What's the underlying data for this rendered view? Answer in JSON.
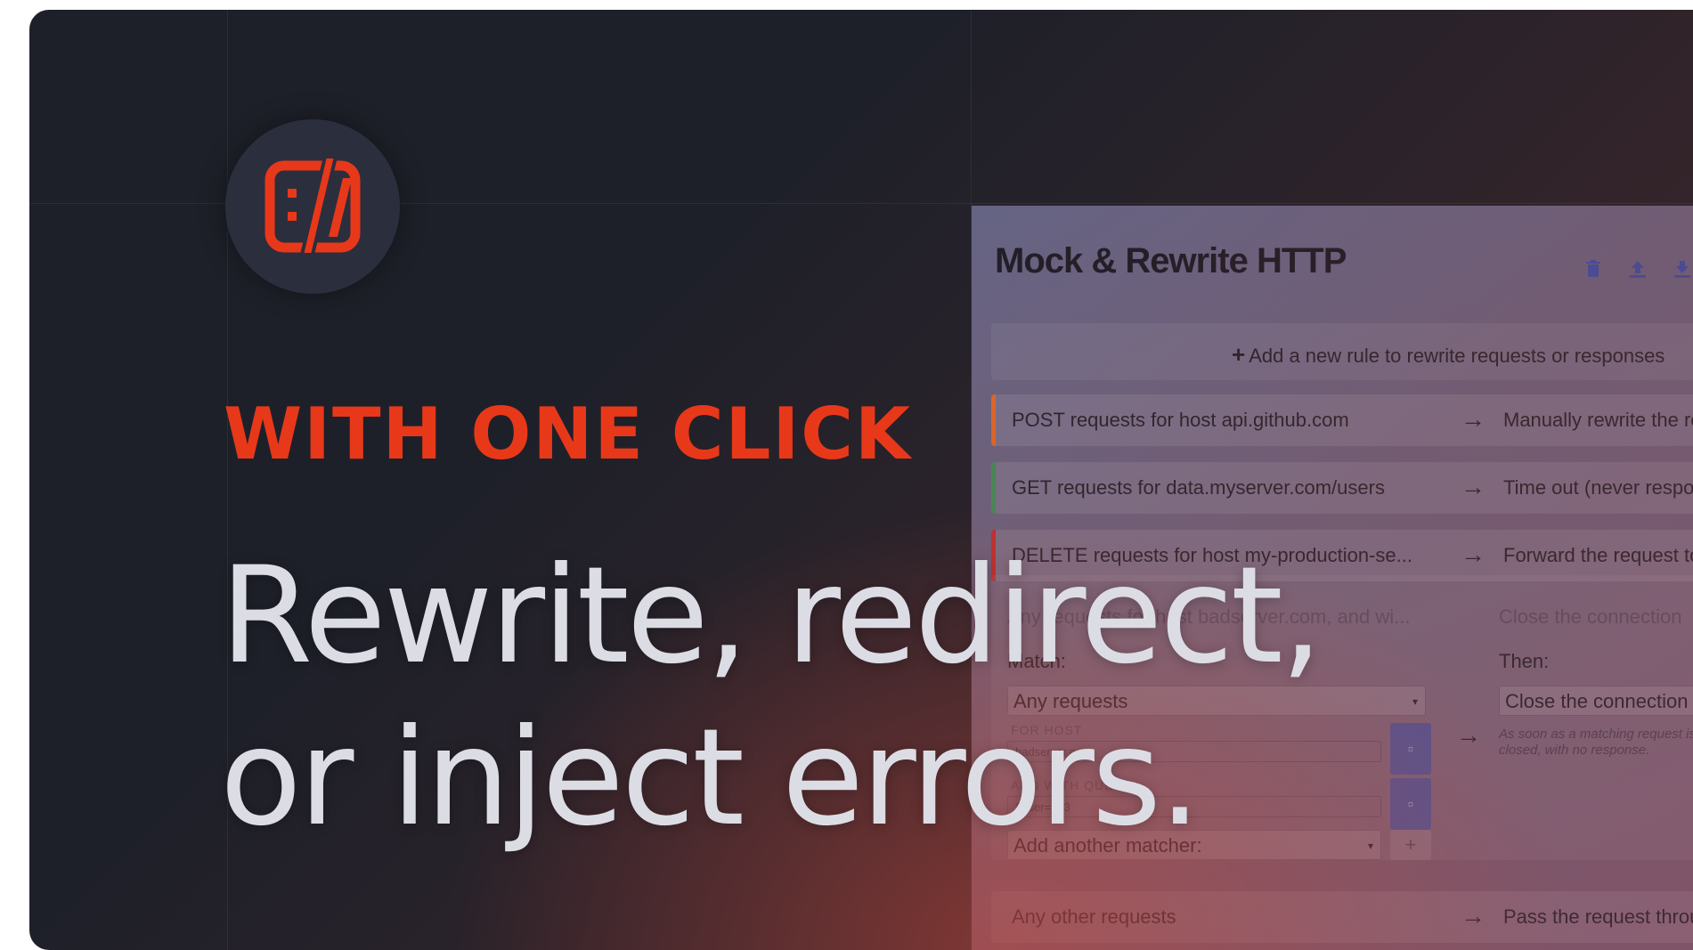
{
  "hero": {
    "logo_icon": "httptoolkit-logo-icon",
    "eyebrow": "WITH ONE CLICK",
    "headline_line1": "Rewrite, redirect,",
    "headline_line2": "or inject errors.",
    "accent_color": "#e8381a"
  },
  "app": {
    "title": "Mock & Rewrite HTTP",
    "toolbar_icons": [
      "trash-icon",
      "upload-icon",
      "download-icon"
    ],
    "add_rule_label": "Add a new rule to rewrite requests or responses",
    "rules": [
      {
        "match": "POST requests for host api.github.com",
        "action": "Manually rewrite the re",
        "color": "#e06a2a"
      },
      {
        "match": "GET requests for data.myserver.com/users",
        "action": "Time out (never respon",
        "color": "#3f8f5a"
      },
      {
        "match": "DELETE requests for host my-production-se...",
        "action": "Forward the request to",
        "color": "#c23030"
      }
    ],
    "expanded_rule": {
      "summary_match": "Any requests for host badserver.com, and wi...",
      "summary_action": "Close the connection",
      "match_label": "Match:",
      "then_label": "Then:",
      "match_select": "Any requests",
      "then_select": "Close the connection i",
      "for_host_label": "FOR HOST",
      "for_host_value": "badserver.com",
      "query_label": "AND WITH QUERY",
      "query_value": "?user=123",
      "add_matcher": "Add another matcher:",
      "help_line1": "As soon as a matching request is",
      "help_line2": "closed, with no response."
    },
    "default_rule": {
      "match": "Any other requests",
      "action": "Pass the request throu"
    }
  }
}
